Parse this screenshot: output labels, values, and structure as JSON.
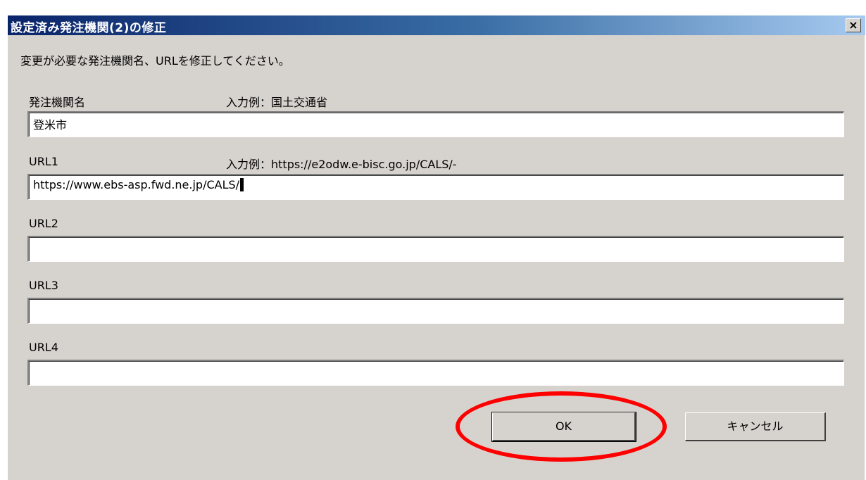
{
  "dialog": {
    "title": "設定済み発注機関(2)の修正",
    "close_label": "×",
    "instruction": "変更が必要な発注機関名、URLを修正してください。",
    "agency": {
      "label": "発注機関名",
      "example": "入力例：国土交通省",
      "value": "登米市"
    },
    "url1": {
      "label": "URL1",
      "example": "入力例：https://e2odw.e-bisc.go.jp/CALS/-",
      "value": "https://www.ebs-asp.fwd.ne.jp/CALS/"
    },
    "url2": {
      "label": "URL2",
      "value": ""
    },
    "url3": {
      "label": "URL3",
      "value": ""
    },
    "url4": {
      "label": "URL4",
      "value": ""
    },
    "ok_label": "OK",
    "cancel_label": "キャンセル"
  },
  "annotation": {
    "highlight_color": "#ff0000",
    "target": "ok-button"
  }
}
